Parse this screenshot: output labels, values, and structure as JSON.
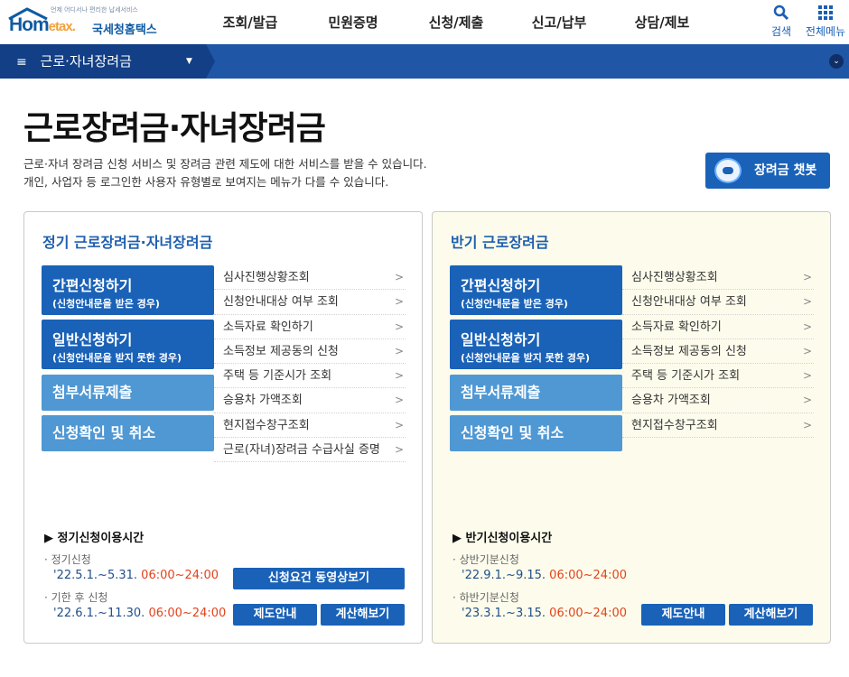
{
  "header": {
    "logo": {
      "tagline": "언제 어디서나 편리한 납세서비스",
      "brand": "Hom",
      "brand_accent": "etax.",
      "name": "국세청홈택스"
    },
    "nav": [
      "조회/발급",
      "민원증명",
      "신청/제출",
      "신고/납부",
      "상담/제보"
    ],
    "search_label": "검색",
    "allmenu_label": "전체메뉴"
  },
  "location": {
    "current": "근로·자녀장려금",
    "hamburger": "≡"
  },
  "page": {
    "title": "근로장려금·자녀장려금",
    "desc_line1": "근로·자녀 장려금 신청 서비스 및 장려금 관련 제도에 대한 서비스를 받을 수 있습니다.",
    "desc_line2": "개인, 사업자 등 로그인한 사용자 유형별로 보여지는 메뉴가 다를 수 있습니다.",
    "chatbot_label": "장려금 챗봇"
  },
  "regular": {
    "title": "정기 근로장려금·자녀장려금",
    "btn_simple": "간편신청하기",
    "btn_simple_sub": "(신청안내문을 받은 경우)",
    "btn_general": "일반신청하기",
    "btn_general_sub": "(신청안내문을 받지 못한 경우)",
    "btn_attach": "첨부서류제출",
    "btn_confirm": "신청확인 및 취소",
    "menu": [
      "심사진행상황조회",
      "신청안내대상 여부 조회",
      "소득자료 확인하기",
      "소득정보 제공동의 신청",
      "주택 등 기준시가 조회",
      "승용차 가액조회",
      "현지접수창구조회",
      "근로(자녀)장려금 수급사실 증명"
    ],
    "schedule_title": "▶ 정기신청이용시간",
    "s1_label": "정기신청",
    "s1_date": "'22.5.1.~5.31.",
    "s1_time": "06:00~24:00",
    "s2_label": "기한 후 신청",
    "s2_date": "'22.6.1.~11.30.",
    "s2_time": "06:00~24:00",
    "btn_video": "신청요건 동영상보기",
    "btn_guide": "제도안내",
    "btn_calc": "계산해보기"
  },
  "half": {
    "title": "반기 근로장려금",
    "btn_simple": "간편신청하기",
    "btn_simple_sub": "(신청안내문을 받은 경우)",
    "btn_general": "일반신청하기",
    "btn_general_sub": "(신청안내문을 받지 못한 경우)",
    "btn_attach": "첨부서류제출",
    "btn_confirm": "신청확인 및 취소",
    "menu": [
      "심사진행상황조회",
      "신청안내대상 여부 조회",
      "소득자료 확인하기",
      "소득정보 제공동의 신청",
      "주택 등 기준시가 조회",
      "승용차 가액조회",
      "현지접수창구조회"
    ],
    "schedule_title": "▶ 반기신청이용시간",
    "s1_label": "상반기분신청",
    "s1_date": "'22.9.1.~9.15.",
    "s1_time": "06:00~24:00",
    "s2_label": "하반기분신청",
    "s2_date": "'23.3.1.~3.15.",
    "s2_time": "06:00~24:00",
    "btn_guide": "제도안내",
    "btn_calc": "계산해보기"
  },
  "colors": {
    "primary": "#1a62b8",
    "light_button": "#4f98d4",
    "locbar": "#1f56a6",
    "accent_time": "#e3421b",
    "half_panel_bg": "#fdfcec"
  }
}
